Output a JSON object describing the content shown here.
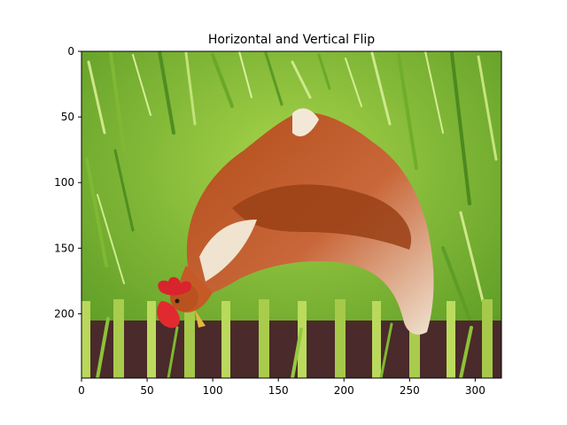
{
  "chart_data": {
    "type": "image",
    "title": "Horizontal and Vertical Flip",
    "xlabel": "",
    "ylabel": "",
    "image_extent": {
      "width": 320,
      "height": 249
    },
    "xlim": [
      0,
      320
    ],
    "ylim": [
      249,
      0
    ],
    "y_inverted": true,
    "grid": false,
    "xticks": [
      0,
      50,
      100,
      150,
      200,
      250,
      300
    ],
    "yticks": [
      0,
      50,
      100,
      150,
      200
    ],
    "image_content": "hen-in-grass-photo",
    "colors": {
      "grass_light": "#9ccc3c",
      "grass_mid": "#6fae2a",
      "grass_dark": "#3f7a1e",
      "feather_brown": "#a8471a",
      "feather_cream": "#f1e6d6",
      "comb_red": "#d8242c",
      "fence_dark": "#4a2a2a"
    }
  }
}
